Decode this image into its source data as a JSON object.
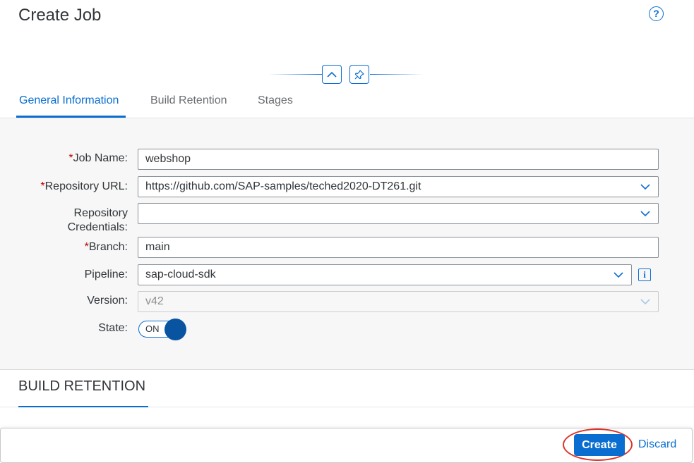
{
  "header": {
    "title": "Create Job",
    "help_icon": "question-circle-icon",
    "collapse_icon": "chevron-up-icon",
    "pin_icon": "pushpin-icon"
  },
  "tabs": [
    {
      "label": "General Information",
      "active": true
    },
    {
      "label": "Build Retention",
      "active": false
    },
    {
      "label": "Stages",
      "active": false
    }
  ],
  "form": {
    "required_mark": "*",
    "job_name": {
      "label": "Job Name:",
      "value": "webshop",
      "required": true
    },
    "repository_url": {
      "label": "Repository URL:",
      "value": "https://github.com/SAP-samples/teched2020-DT261.git",
      "required": true
    },
    "repository_credentials": {
      "label_line1": "Repository",
      "label_line2": "Credentials:",
      "value": "",
      "required": false
    },
    "branch": {
      "label": "Branch:",
      "value": "main",
      "required": true
    },
    "pipeline": {
      "label": "Pipeline:",
      "value": "sap-cloud-sdk",
      "required": false
    },
    "version": {
      "label": "Version:",
      "value": "v42",
      "disabled": true
    },
    "state": {
      "label": "State:",
      "value": "ON"
    }
  },
  "section": {
    "title": "BUILD RETENTION"
  },
  "footer": {
    "create_label": "Create",
    "discard_label": "Discard"
  },
  "colors": {
    "accent": "#0a6ed1",
    "required": "#bb0000",
    "highlight_ring": "#d9342b"
  }
}
